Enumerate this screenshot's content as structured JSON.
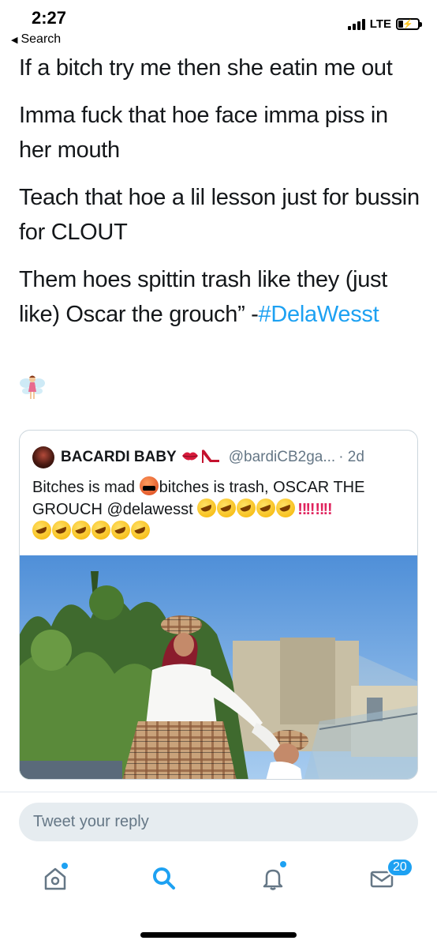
{
  "status_bar": {
    "time": "2:27",
    "back_label": "Search",
    "network": "LTE"
  },
  "tweet": {
    "lines": [
      "If a bitch try me then she eatin me out",
      "Imma fuck that hoe face imma piss in her mouth",
      "Teach that hoe a lil lesson just for bussin for CLOUT"
    ],
    "last_line_text": "Them hoes spittin trash like they (just like) Oscar the grouch” -",
    "hashtag": "#DelaWesst",
    "emoji": "fairy-icon"
  },
  "quote": {
    "name": "BACARDI BABY",
    "handle": "@bardiCB2ga...",
    "time": "· 2d",
    "text_part1": "Bitches is mad",
    "text_part2": "bitches is trash, OSCAR THE GROUCH @delawesst",
    "bangs": "‼‼"
  },
  "reply": {
    "placeholder": "Tweet your reply"
  },
  "tab_bar": {
    "items": [
      "home-icon",
      "search-icon",
      "notifications-icon",
      "messages-icon"
    ],
    "messages_badge": "20"
  },
  "colors": {
    "accent": "#1da1f2",
    "text": "#14171a",
    "secondary": "#657786",
    "reply_bg": "#e6ecf0"
  }
}
